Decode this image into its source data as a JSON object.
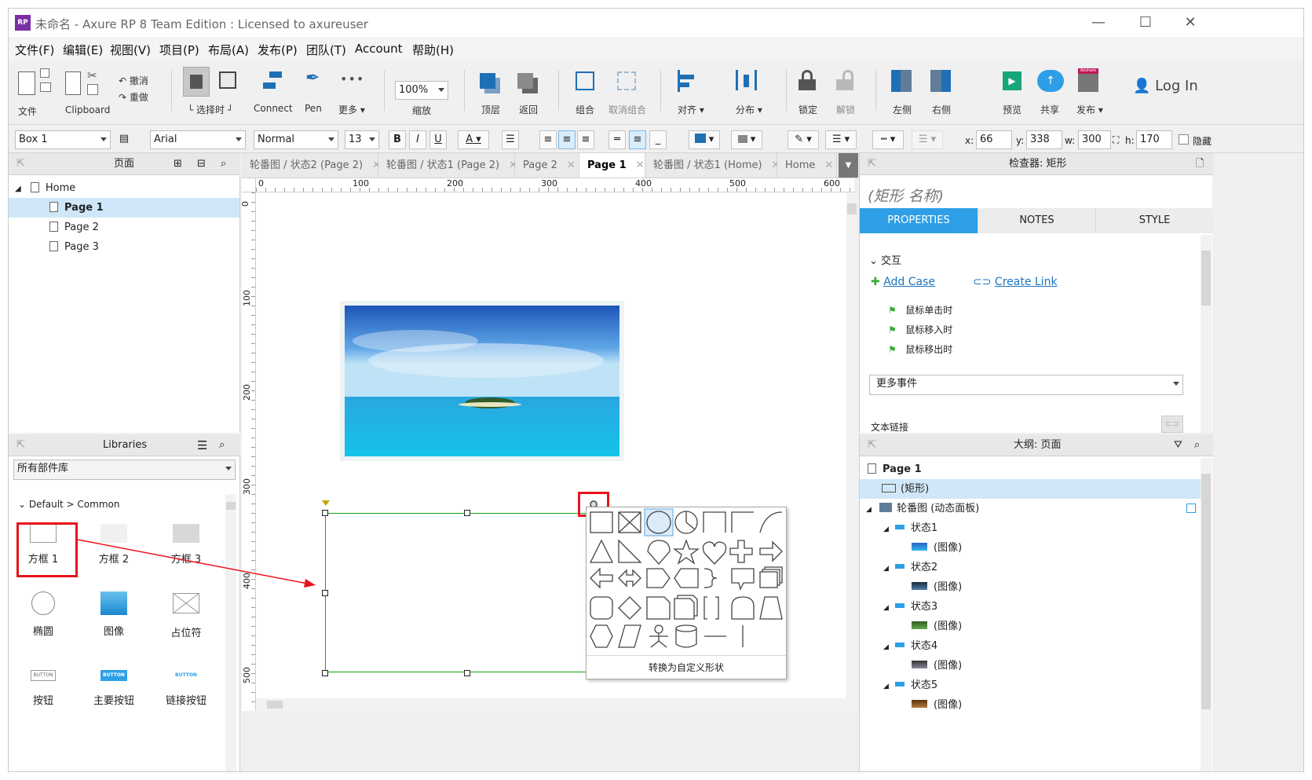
{
  "window": {
    "title": "未命名 - Axure RP 8 Team Edition : Licensed to axureuser",
    "app_icon_label": "RP",
    "controls": {
      "minimize": "—",
      "maximize": "☐",
      "close": "✕"
    }
  },
  "menu": [
    "文件(F)",
    "编辑(E)",
    "视图(V)",
    "项目(P)",
    "布局(A)",
    "发布(P)",
    "团队(T)",
    "Account",
    "帮助(H)"
  ],
  "toolbar": {
    "file": "文件",
    "clipboard": "Clipboard",
    "undo": "撤消",
    "redo": "重做",
    "select_mode": "选择时",
    "connect": "Connect",
    "pen": "Pen",
    "more": "更多 ▾",
    "zoom_value": "100%",
    "zoom_label": "缩放",
    "top": "顶层",
    "back": "返回",
    "group": "组合",
    "ungroup": "取消组合",
    "align": "对齐 ▾",
    "distribute": "分布 ▾",
    "lock": "锁定",
    "unlock": "解锁",
    "left": "左侧",
    "right": "右侧",
    "preview": "预览",
    "share": "共享",
    "publish": "发布 ▾",
    "publish_badge": "Axshare",
    "login": "Log In"
  },
  "format": {
    "widget_name": "Box 1",
    "font": "Arial",
    "weight": "Normal",
    "size": "13",
    "bold": "B",
    "italic": "I",
    "underline": "U",
    "font_color": "A",
    "x_label": "x:",
    "x": "66",
    "y_label": "y:",
    "y": "338",
    "w_label": "w:",
    "w": "300",
    "h_label": "h:",
    "h": "170",
    "hide": "隐藏"
  },
  "pages_panel": {
    "title": "页面",
    "root": "Home",
    "pages": [
      "Page 1",
      "Page 2",
      "Page 3"
    ]
  },
  "libraries_panel": {
    "title": "Libraries",
    "selected_library": "所有部件库",
    "category": "Default > Common",
    "items": [
      {
        "label": "方框 1",
        "icon": "box1-icon"
      },
      {
        "label": "方框 2",
        "icon": "box2-icon"
      },
      {
        "label": "方框 3",
        "icon": "box3-icon"
      },
      {
        "label": "椭圆",
        "icon": "ellipse-icon"
      },
      {
        "label": "图像",
        "icon": "image-icon"
      },
      {
        "label": "占位符",
        "icon": "placeholder-icon"
      },
      {
        "label": "按钮",
        "icon": "button-icon",
        "preview": "BUTTON"
      },
      {
        "label": "主要按钮",
        "icon": "primary-button-icon",
        "preview": "BUTTON"
      },
      {
        "label": "链接按钮",
        "icon": "link-button-icon",
        "preview": "BUTTON"
      }
    ]
  },
  "tabs": [
    {
      "label": "轮番图 / 状态2 (Page 2)",
      "active": false
    },
    {
      "label": "轮番图 / 状态1 (Page 2)",
      "active": false
    },
    {
      "label": "Page 2",
      "active": false
    },
    {
      "label": "Page 1",
      "active": true
    },
    {
      "label": "轮番图 / 状态1 (Home)",
      "active": false
    },
    {
      "label": "Home",
      "active": false
    }
  ],
  "ruler": {
    "h_labels": [
      "0",
      "100",
      "200",
      "300",
      "400",
      "500",
      "600"
    ],
    "v_labels": [
      "0",
      "100",
      "200",
      "300",
      "400",
      "500"
    ]
  },
  "shape_picker": {
    "convert_label": "转换为自定义形状",
    "shapes": [
      "rectangle",
      "x-box",
      "ellipse",
      "pie",
      "rect-corner",
      "rect-cut",
      "arc",
      "triangle",
      "right-triangle",
      "tear",
      "star",
      "heart",
      "cross",
      "arrow-right",
      "arrow-left",
      "arrow-both",
      "pentagon-tag",
      "tag-left",
      "brace",
      "callout",
      "stack",
      "rounded-rect",
      "diamond",
      "document",
      "multi-doc",
      "bracket",
      "bell",
      "trapezoid",
      "hexagon",
      "parallelogram",
      "actor",
      "cylinder",
      "hline",
      "vline"
    ]
  },
  "inspector": {
    "title": "检查器: 矩形",
    "name_placeholder": "(矩形 名称)",
    "tabs": [
      "PROPERTIES",
      "NOTES",
      "STYLE"
    ],
    "interaction_section": "交互",
    "add_case": "Add Case",
    "create_link": "Create Link",
    "events": [
      "鼠标单击时",
      "鼠标移入时",
      "鼠标移出时"
    ],
    "more_events": "更多事件",
    "text_link": "文本链接"
  },
  "outline": {
    "title": "大纲: 页面",
    "rows": [
      {
        "label": "Page 1",
        "level": 0,
        "icon": "page-icon",
        "bold": true
      },
      {
        "label": "(矩形)",
        "level": 1,
        "icon": "rect-icon",
        "selected": true
      },
      {
        "label": "轮番图 (动态面板)",
        "level": 1,
        "icon": "dynamic-panel-icon",
        "expand": "◢"
      },
      {
        "label": "状态1",
        "level": 2,
        "icon": "state-icon",
        "expand": "◢"
      },
      {
        "label": "(图像)",
        "level": 3,
        "icon": "image-thumb-icon"
      },
      {
        "label": "状态2",
        "level": 2,
        "icon": "state-icon",
        "expand": "◢"
      },
      {
        "label": "(图像)",
        "level": 3,
        "icon": "image-thumb-icon"
      },
      {
        "label": "状态3",
        "level": 2,
        "icon": "state-icon",
        "expand": "◢"
      },
      {
        "label": "(图像)",
        "level": 3,
        "icon": "image-thumb-icon"
      },
      {
        "label": "状态4",
        "level": 2,
        "icon": "state-icon",
        "expand": "◢"
      },
      {
        "label": "(图像)",
        "level": 3,
        "icon": "image-thumb-icon"
      },
      {
        "label": "状态5",
        "level": 2,
        "icon": "state-icon",
        "expand": "◢"
      },
      {
        "label": "(图像)",
        "level": 3,
        "icon": "image-thumb-icon"
      }
    ]
  },
  "colors": {
    "accent": "#2e9fe6",
    "selection_green": "#1aa51a",
    "annotation_red": "#e8141b",
    "tree_selected": "#cfe7f8"
  }
}
